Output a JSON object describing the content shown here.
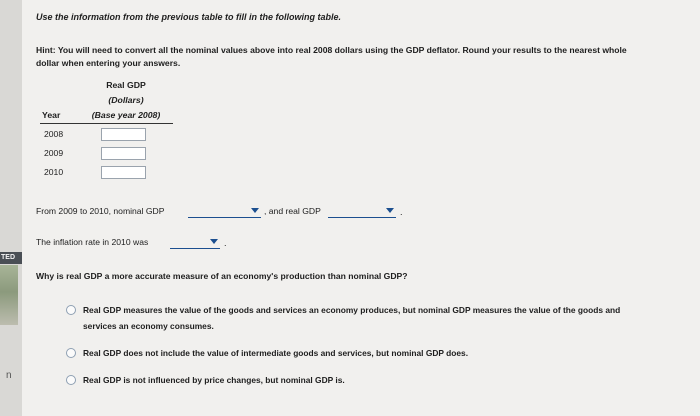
{
  "sidebar": {
    "badge": "TED",
    "glyph": "n"
  },
  "intro": "Use the information from the previous table to fill in the following table.",
  "hint": {
    "label": "Hint:",
    "line1": "You will need to convert all the nominal values above into real 2008 dollars using the GDP deflator. Round your results to the nearest whole",
    "line2": "dollar when entering your answers."
  },
  "table": {
    "header": {
      "col1": "Year",
      "real": "Real GDP",
      "dollars": "(Dollars)",
      "base": "(Base year 2008)"
    },
    "rows": [
      {
        "year": "2008",
        "value": ""
      },
      {
        "year": "2009",
        "value": ""
      },
      {
        "year": "2010",
        "value": ""
      }
    ]
  },
  "question1": {
    "text_before": "From 2009 to 2010, nominal GDP",
    "text_middle": ", and real GDP",
    "end": "."
  },
  "question2": {
    "text": "The inflation rate in 2010 was",
    "end": "."
  },
  "question3": {
    "prompt": "Why is real GDP a more accurate measure of an economy's production than nominal GDP?",
    "options": [
      {
        "line1": "Real GDP measures the value of the goods and services an economy produces, but nominal GDP measures the value of the goods and",
        "line2": "services an economy consumes."
      },
      {
        "line1": "Real GDP does not include the value of intermediate goods and services, but nominal GDP does.",
        "line2": ""
      },
      {
        "line1": "Real GDP is not influenced by price changes, but nominal GDP is.",
        "line2": ""
      }
    ]
  },
  "colors": {
    "accent": "#1c4f8f",
    "input_border": "#9aa3ad"
  }
}
